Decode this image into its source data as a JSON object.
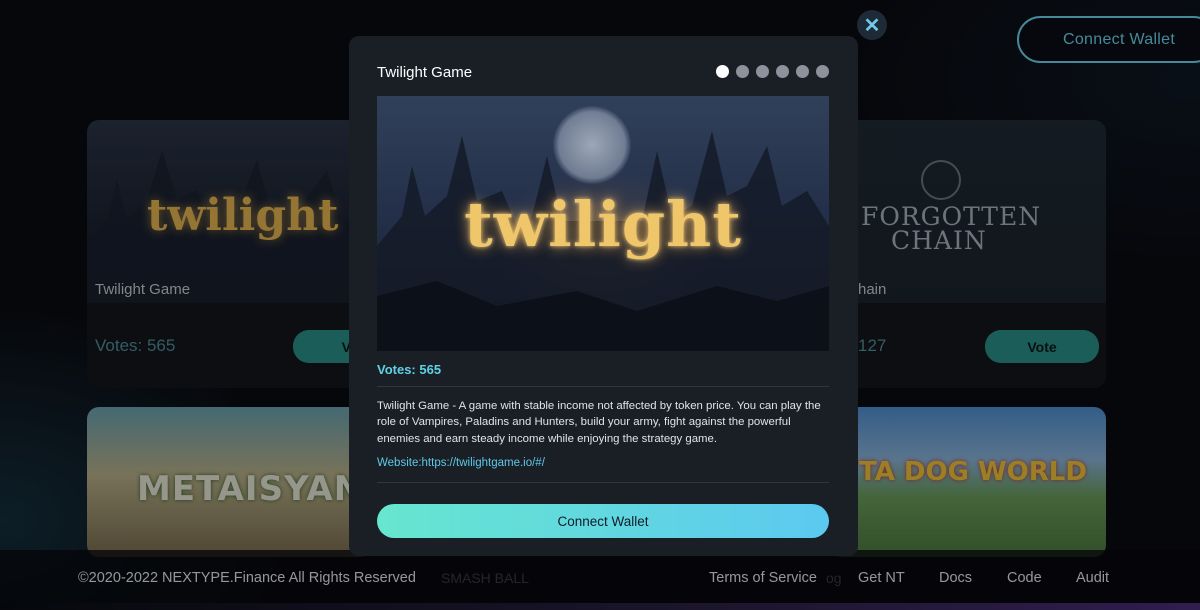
{
  "header": {
    "connect_wallet_label": "Connect Wallet"
  },
  "cards": [
    {
      "name": "Twilight Game",
      "votes": "Votes: 565",
      "logo": "twilight",
      "vote_label": "Vo"
    },
    {
      "name": "hain",
      "votes": "127",
      "logo_line1": "FORGOTTEN",
      "logo_line2": "CHAIN",
      "vote_label": "Vote"
    },
    {
      "logo": "METAISYANI"
    },
    {
      "logo": "TA DOG WORLD"
    }
  ],
  "modal": {
    "title": "Twilight Game",
    "slide_count": 6,
    "active_slide": 1,
    "hero_logo": "twilight",
    "votes": "Votes: 565",
    "description": "Twilight Game - A game with stable income not affected by token price. You can play the role of Vampires, Paladins and Hunters, build your army, fight against the powerful enemies and earn steady income while enjoying the strategy game.",
    "website": "Website:https://twilightgame.io/#/",
    "connect_label": "Connect Wallet",
    "close_glyph": "✕"
  },
  "footer": {
    "copyright": "©2020-2022 NEXTYPE.Finance All Rights Reserved",
    "background_text_1": "SMASH BALL",
    "background_text_2": "og",
    "links": {
      "terms": "Terms of Service",
      "get_nt": "Get NT",
      "docs": "Docs",
      "code": "Code",
      "audit": "Audit"
    }
  },
  "colors": {
    "accent": "#5fd2e3",
    "modal_bg": "#1a1f26",
    "vote_button": "#2a8f87"
  }
}
